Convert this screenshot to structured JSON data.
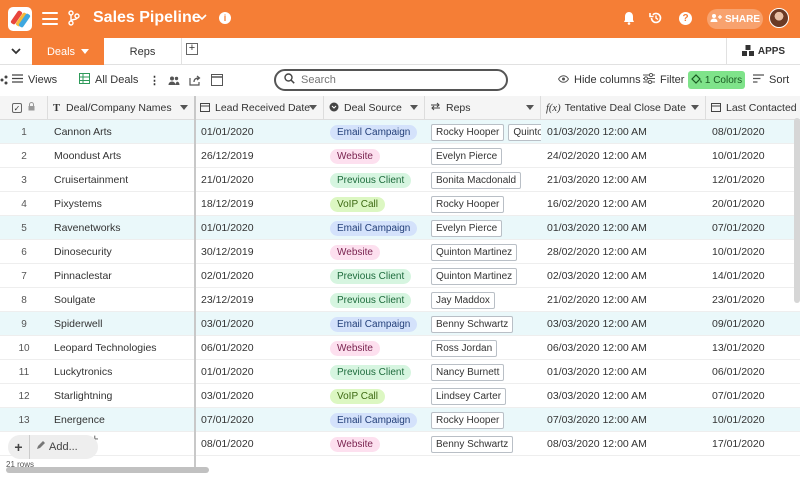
{
  "app": {
    "title": "Sales Pipeline",
    "share_label": "SHARE",
    "brand_color": "#f57e36",
    "icons": [
      "menu-icon",
      "branch-icon",
      "chevron-down-icon",
      "info-icon",
      "bell-icon",
      "history-icon",
      "help-icon",
      "share-icon",
      "avatar"
    ]
  },
  "tabs": {
    "active": "Deals",
    "other": "Reps",
    "add_symbol": "+",
    "apps_label": "APPS",
    "collapse_symbol": "❯"
  },
  "toolbar": {
    "views_label": "Views",
    "view_name": "All Deals",
    "search_placeholder": "Search",
    "hide_columns_label": "Hide columns",
    "filter_label": "Filter",
    "colors_label": "1 Colors",
    "sort_label": "Sort"
  },
  "columns": [
    {
      "label": "Deal/Company Names",
      "icon": "T"
    },
    {
      "label": "Lead Received Date",
      "icon": "calendar-icon"
    },
    {
      "label": "Deal Source",
      "icon": "dropdown-icon"
    },
    {
      "label": "Reps",
      "icon": "link-icon"
    },
    {
      "label": "Tentative Deal Close Date",
      "icon": "formula-icon"
    },
    {
      "label": "Last Contacted",
      "icon": "calendar-icon"
    }
  ],
  "source_colors": {
    "Email Campaign": {
      "bg": "#d4e2fb",
      "fg": "#24407a"
    },
    "Website": {
      "bg": "#fde0ef",
      "fg": "#7a2450"
    },
    "Previous Client": {
      "bg": "#d6f5e0",
      "fg": "#1d6b3c"
    },
    "VoIP Call": {
      "bg": "#dcf7c2",
      "fg": "#3d6a12"
    }
  },
  "rows": [
    {
      "n": "1",
      "name": "Cannon Arts",
      "lead": "01/01/2020",
      "source": "Email Campaign",
      "reps": [
        "Rocky Hooper",
        "Quinton Martinez"
      ],
      "close": "01/03/2020 12:00 AM",
      "last": "08/01/2020",
      "hl": true
    },
    {
      "n": "2",
      "name": "Moondust Arts",
      "lead": "26/12/2019",
      "source": "Website",
      "reps": [
        "Evelyn Pierce"
      ],
      "close": "24/02/2020 12:00 AM",
      "last": "10/01/2020",
      "hl": false
    },
    {
      "n": "3",
      "name": "Cruisertainment",
      "lead": "21/01/2020",
      "source": "Previous Client",
      "reps": [
        "Bonita Macdonald"
      ],
      "close": "21/03/2020 12:00 AM",
      "last": "12/01/2020",
      "hl": false
    },
    {
      "n": "4",
      "name": "Pixystems",
      "lead": "18/12/2019",
      "source": "VoIP Call",
      "reps": [
        "Rocky Hooper"
      ],
      "close": "16/02/2020 12:00 AM",
      "last": "20/01/2020",
      "hl": false
    },
    {
      "n": "5",
      "name": "Ravenetworks",
      "lead": "01/01/2020",
      "source": "Email Campaign",
      "reps": [
        "Evelyn Pierce"
      ],
      "close": "01/03/2020 12:00 AM",
      "last": "07/01/2020",
      "hl": true
    },
    {
      "n": "6",
      "name": "Dinosecurity",
      "lead": "30/12/2019",
      "source": "Website",
      "reps": [
        "Quinton Martinez"
      ],
      "close": "28/02/2020 12:00 AM",
      "last": "10/01/2020",
      "hl": false
    },
    {
      "n": "7",
      "name": "Pinnaclestar",
      "lead": "02/01/2020",
      "source": "Previous Client",
      "reps": [
        "Quinton Martinez"
      ],
      "close": "02/03/2020 12:00 AM",
      "last": "14/01/2020",
      "hl": false
    },
    {
      "n": "8",
      "name": "Soulgate",
      "lead": "23/12/2019",
      "source": "Previous Client",
      "reps": [
        "Jay Maddox"
      ],
      "close": "21/02/2020 12:00 AM",
      "last": "23/01/2020",
      "hl": false
    },
    {
      "n": "9",
      "name": "Spiderwell",
      "lead": "03/01/2020",
      "source": "Email Campaign",
      "reps": [
        "Benny Schwartz"
      ],
      "close": "03/03/2020 12:00 AM",
      "last": "09/01/2020",
      "hl": true
    },
    {
      "n": "10",
      "name": "Leopard Technologies",
      "lead": "06/01/2020",
      "source": "Website",
      "reps": [
        "Ross Jordan"
      ],
      "close": "06/03/2020 12:00 AM",
      "last": "13/01/2020",
      "hl": false
    },
    {
      "n": "11",
      "name": "Luckytronics",
      "lead": "01/01/2020",
      "source": "Previous Client",
      "reps": [
        "Nancy Burnett"
      ],
      "close": "01/03/2020 12:00 AM",
      "last": "06/01/2020",
      "hl": false
    },
    {
      "n": "12",
      "name": "Starlightning",
      "lead": "03/01/2020",
      "source": "VoIP Call",
      "reps": [
        "Lindsey Carter"
      ],
      "close": "03/03/2020 12:00 AM",
      "last": "07/01/2020",
      "hl": false
    },
    {
      "n": "13",
      "name": "Energence",
      "lead": "07/01/2020",
      "source": "Email Campaign",
      "reps": [
        "Rocky Hooper"
      ],
      "close": "07/03/2020 12:00 AM",
      "last": "10/01/2020",
      "hl": true
    },
    {
      "n": "",
      "name": "",
      "lead": "08/01/2020",
      "source": "Website",
      "reps": [
        "Benny Schwartz"
      ],
      "close": "08/03/2020 12:00 AM",
      "last": "17/01/2020",
      "hl": false
    }
  ],
  "footer": {
    "add_label": "Add...",
    "plus_symbol": "+",
    "row_count": "21 rows"
  }
}
